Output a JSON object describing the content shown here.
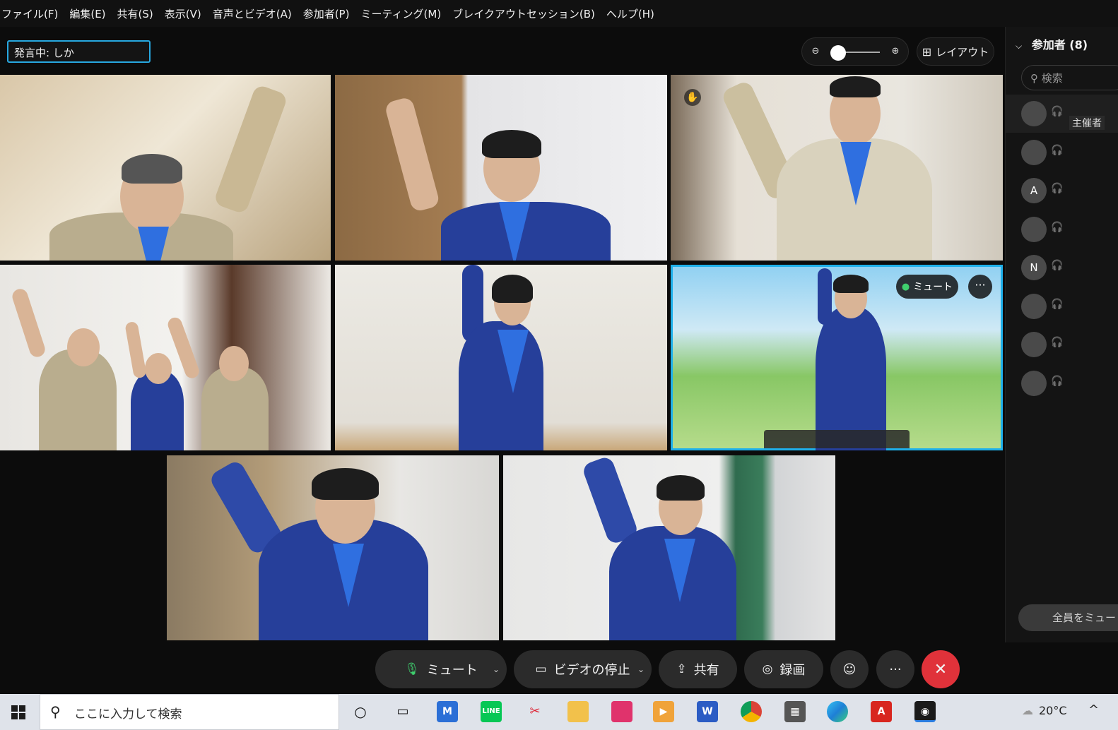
{
  "menu": [
    "ファイル(F)",
    "編集(E)",
    "共有(S)",
    "表示(V)",
    "音声とビデオ(A)",
    "参加者(P)",
    "ミーティング(M)",
    "ブレイクアウトセッション(B)",
    "ヘルプ(H)"
  ],
  "speaking_label": "発言中: しか",
  "zoom": {
    "level": 0.0
  },
  "layout_label": "レイアウト",
  "active_tile": {
    "mute_label": "ミュート",
    "more_label": "···"
  },
  "controls": {
    "mute_label": "ミュート",
    "video_label": "ビデオの停止",
    "share_label": "共有",
    "record_label": "録画",
    "more_label": "···",
    "leave_icon": "✕"
  },
  "participants": {
    "title": "参加者 (8)",
    "search_placeholder": "検索",
    "host_tag": "主催者",
    "rows": [
      {
        "avatar": ""
      },
      {
        "avatar": ""
      },
      {
        "avatar": "A"
      },
      {
        "avatar": ""
      },
      {
        "avatar": "N"
      },
      {
        "avatar": ""
      },
      {
        "avatar": ""
      },
      {
        "avatar": ""
      }
    ],
    "mute_all_label": "全員をミュー"
  },
  "taskbar": {
    "search_placeholder": "ここに入力して検索",
    "apps": [
      "cortana",
      "task-view",
      "gmail",
      "line",
      "snipping",
      "explorer",
      "office",
      "clipchamp",
      "word",
      "chrome",
      "calculator",
      "edge",
      "acrobat",
      "webex"
    ],
    "temperature": "20°C"
  },
  "colors": {
    "accent": "#1fb0ea",
    "leave": "#e0323a",
    "mic_green": "#3fcf6e"
  }
}
